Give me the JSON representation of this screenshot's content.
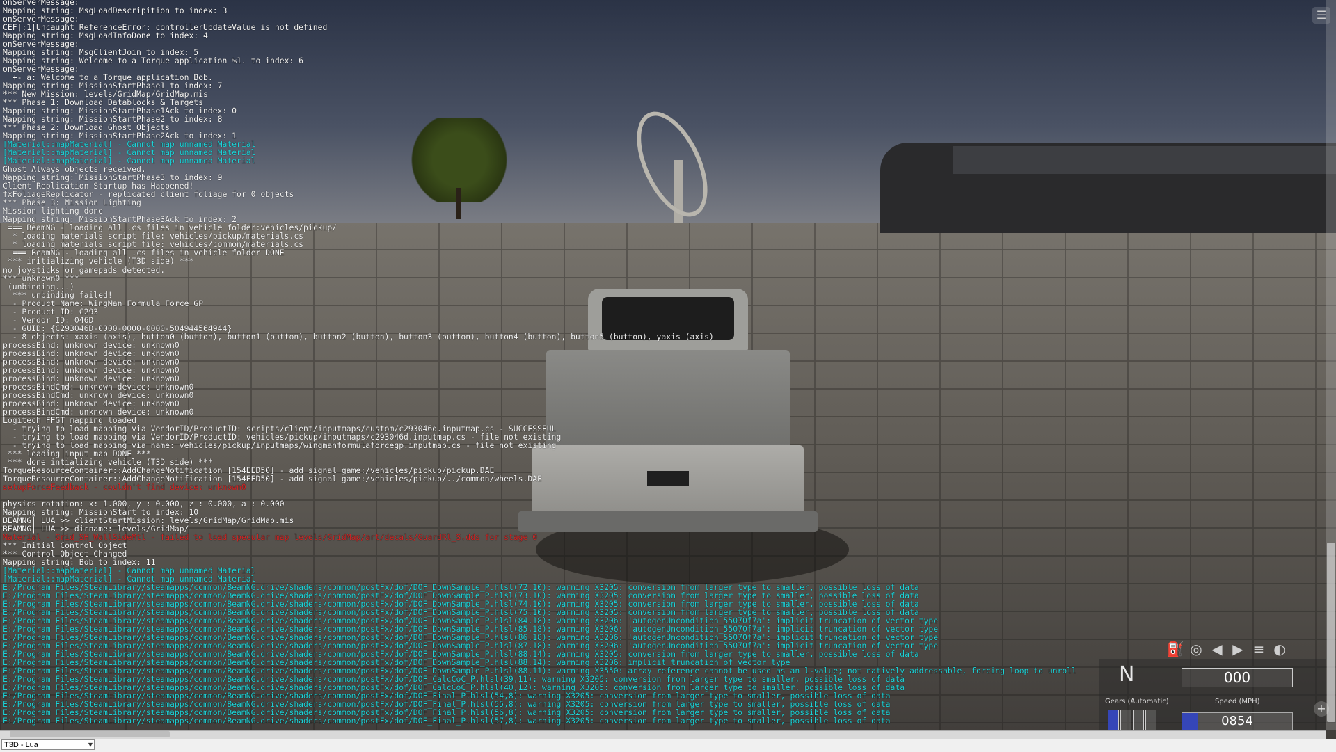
{
  "console": {
    "lines": [
      {
        "text": "onServerMessage:",
        "color": "#f4f4f4"
      },
      {
        "text": "Mapping string: MsgLoadDescripition to index: 3",
        "color": "#f4f4f4"
      },
      {
        "text": "onServerMessage:",
        "color": "#f4f4f4"
      },
      {
        "text": "CEF|:1|Uncaught ReferenceError: controllerUpdateValue is not defined",
        "color": "#f4f4f4"
      },
      {
        "text": "Mapping string: MsgLoadInfoDone to index: 4",
        "color": "#f4f4f4"
      },
      {
        "text": "onServerMessage:",
        "color": "#f4f4f4"
      },
      {
        "text": "Mapping string: MsgClientJoin to index: 5",
        "color": "#f4f4f4"
      },
      {
        "text": "Mapping string: Welcome to a Torque application %1. to index: 6",
        "color": "#f4f4f4"
      },
      {
        "text": "onServerMessage:",
        "color": "#f4f4f4"
      },
      {
        "text": "  +- a: Welcome to a Torque application Bob.",
        "color": "#f4f4f4"
      },
      {
        "text": "Mapping string: MissionStartPhase1 to index: 7",
        "color": "#f4f4f4"
      },
      {
        "text": "*** New Mission: levels/GridMap/GridMap.mis",
        "color": "#f4f4f4"
      },
      {
        "text": "*** Phase 1: Download Datablocks & Targets",
        "color": "#f4f4f4"
      },
      {
        "text": "Mapping string: MissionStartPhase1Ack to index: 0",
        "color": "#f4f4f4"
      },
      {
        "text": "Mapping string: MissionStartPhase2 to index: 8",
        "color": "#f4f4f4"
      },
      {
        "text": "*** Phase 2: Download Ghost Objects",
        "color": "#f4f4f4"
      },
      {
        "text": "Mapping string: MissionStartPhase2Ack to index: 1",
        "color": "#f4f4f4"
      },
      {
        "text": "[Material::mapMaterial] - Cannot map unnamed Material",
        "color": "#1ed3d8"
      },
      {
        "text": "[Material::mapMaterial] - Cannot map unnamed Material",
        "color": "#1ed3d8"
      },
      {
        "text": "[Material::mapMaterial] - Cannot map unnamed Material",
        "color": "#1ed3d8"
      },
      {
        "text": "Ghost Always objects received.",
        "color": "#f4f4f4"
      },
      {
        "text": "Mapping string: MissionStartPhase3 to index: 9",
        "color": "#f4f4f4"
      },
      {
        "text": "Client Replication Startup has Happened!",
        "color": "#f4f4f4"
      },
      {
        "text": "fxFoliageReplicator - replicated client foliage for 0 objects",
        "color": "#f4f4f4"
      },
      {
        "text": "*** Phase 3: Mission Lighting",
        "color": "#f4f4f4"
      },
      {
        "text": "Mission lighting done",
        "color": "#f4f4f4"
      },
      {
        "text": "Mapping string: MissionStartPhase3Ack to index: 2",
        "color": "#f4f4f4"
      },
      {
        "text": " === BeamNG - loading all .cs files in vehicle folder:vehicles/pickup/",
        "color": "#f4f4f4"
      },
      {
        "text": "  * loading materials script file: vehicles/pickup/materials.cs",
        "color": "#f4f4f4"
      },
      {
        "text": "  * loading materials script file: vehicles/common/materials.cs",
        "color": "#f4f4f4"
      },
      {
        "text": "  === BeamNG - loading all .cs files in vehicle folder DONE",
        "color": "#f4f4f4"
      },
      {
        "text": " *** initializing vehicle (T3D side) ***",
        "color": "#f4f4f4"
      },
      {
        "text": "no joysticks or gamepads detected.",
        "color": "#f4f4f4"
      },
      {
        "text": "*** unknown0 ***",
        "color": "#f4f4f4"
      },
      {
        "text": " (unbinding...)",
        "color": "#f4f4f4"
      },
      {
        "text": "  *** unbinding failed!",
        "color": "#f4f4f4"
      },
      {
        "text": "  - Product Name: WingMan Formula Force GP",
        "color": "#f4f4f4"
      },
      {
        "text": "  - Product ID: C293",
        "color": "#f4f4f4"
      },
      {
        "text": "  - Vendor ID: 046D",
        "color": "#f4f4f4"
      },
      {
        "text": "  - GUID: {C293046D-0000-0000-0000-504944564944}",
        "color": "#f4f4f4"
      },
      {
        "text": "  - 8 objects: xaxis (axis), button0 (button), button1 (button), button2 (button), button3 (button), button4 (button), button5 (button), yaxis (axis)",
        "color": "#f4f4f4"
      },
      {
        "text": "processBind: unknown device: unknown0",
        "color": "#f4f4f4"
      },
      {
        "text": "processBind: unknown device: unknown0",
        "color": "#f4f4f4"
      },
      {
        "text": "processBind: unknown device: unknown0",
        "color": "#f4f4f4"
      },
      {
        "text": "processBind: unknown device: unknown0",
        "color": "#f4f4f4"
      },
      {
        "text": "processBind: unknown device: unknown0",
        "color": "#f4f4f4"
      },
      {
        "text": "processBindCmd: unknown device: unknown0",
        "color": "#f4f4f4"
      },
      {
        "text": "processBindCmd: unknown device: unknown0",
        "color": "#f4f4f4"
      },
      {
        "text": "processBind: unknown device: unknown0",
        "color": "#f4f4f4"
      },
      {
        "text": "processBindCmd: unknown device: unknown0",
        "color": "#f4f4f4"
      },
      {
        "text": "Logitech FFGT mapping loaded",
        "color": "#f4f4f4"
      },
      {
        "text": "  - trying to load mapping via VendorID/ProductID: scripts/client/inputmaps/custom/c293046d.inputmap.cs - SUCCESSFUL",
        "color": "#f4f4f4"
      },
      {
        "text": "  - trying to load mapping via VendorID/ProductID: vehicles/pickup/inputmaps/c293046d.inputmap.cs - file not existing",
        "color": "#f4f4f4"
      },
      {
        "text": "  - trying to load mapping via name: vehicles/pickup/inputmaps/wingmanformulaforcegp.inputmap.cs - file not existing",
        "color": "#f4f4f4"
      },
      {
        "text": " *** loading input map DONE ***",
        "color": "#f4f4f4"
      },
      {
        "text": " *** done intializing vehicle (T3D side) ***",
        "color": "#f4f4f4"
      },
      {
        "text": "TorqueResourceContainer::AddChangeNotification [154EED50] - add signal game:/vehicles/pickup/pickup.DAE",
        "color": "#f4f4f4"
      },
      {
        "text": "TorqueResourceContainer::AddChangeNotification [154EED50] - add signal game:/vehicles/pickup/../common/wheels.DAE",
        "color": "#f4f4f4"
      },
      {
        "text": "setupForceFeedback - couldn't find device: unknown0",
        "color": "#d42626"
      },
      {
        "text": "",
        "color": "#f4f4f4"
      },
      {
        "text": "physics rotation: x: 1.000, y : 0.000, z : 0.000, a : 0.000",
        "color": "#f4f4f4"
      },
      {
        "text": "Mapping string: MissionStart to index: 10",
        "color": "#f4f4f4"
      },
      {
        "text": "BEAMNG| LUA >> clientStartMission: levels/GridMap/GridMap.mis",
        "color": "#f4f4f4"
      },
      {
        "text": "BEAMNG| LUA >> dirname: levels/GridMap/",
        "color": "#f4f4f4"
      },
      {
        "text": "Material - Grid_SH_WallSideMtl - failed to load specular map levels/GridMap/art/decals/GuardRl_S.dds for stage 0",
        "color": "#d42626"
      },
      {
        "text": "*** Initial Control Object",
        "color": "#f4f4f4"
      },
      {
        "text": "*** Control Object Changed",
        "color": "#f4f4f4"
      },
      {
        "text": "Mapping string: Bob to index: 11",
        "color": "#f4f4f4"
      },
      {
        "text": "[Material::mapMaterial] - Cannot map unnamed Material",
        "color": "#1ed3d8"
      },
      {
        "text": "[Material::mapMaterial] - Cannot map unnamed Material",
        "color": "#1ed3d8"
      },
      {
        "text": "E:/Program Files/SteamLibrary/steamapps/common/BeamNG.drive/shaders/common/postFx/dof/DOF_DownSample_P.hlsl(72,10): warning X3205: conversion from larger type to smaller, possible loss of data",
        "color": "#1ed3d8"
      },
      {
        "text": "E:/Program Files/SteamLibrary/steamapps/common/BeamNG.drive/shaders/common/postFx/dof/DOF_DownSample_P.hlsl(73,10): warning X3205: conversion from larger type to smaller, possible loss of data",
        "color": "#1ed3d8"
      },
      {
        "text": "E:/Program Files/SteamLibrary/steamapps/common/BeamNG.drive/shaders/common/postFx/dof/DOF_DownSample_P.hlsl(74,10): warning X3205: conversion from larger type to smaller, possible loss of data",
        "color": "#1ed3d8"
      },
      {
        "text": "E:/Program Files/SteamLibrary/steamapps/common/BeamNG.drive/shaders/common/postFx/dof/DOF_DownSample_P.hlsl(75,10): warning X3205: conversion from larger type to smaller, possible loss of data",
        "color": "#1ed3d8"
      },
      {
        "text": "E:/Program Files/SteamLibrary/steamapps/common/BeamNG.drive/shaders/common/postFx/dof/DOF_DownSample_P.hlsl(84,18): warning X3206: 'autogenUncondition_55070f7a': implicit truncation of vector type",
        "color": "#1ed3d8"
      },
      {
        "text": "E:/Program Files/SteamLibrary/steamapps/common/BeamNG.drive/shaders/common/postFx/dof/DOF_DownSample_P.hlsl(85,18): warning X3206: 'autogenUncondition_55070f7a': implicit truncation of vector type",
        "color": "#1ed3d8"
      },
      {
        "text": "E:/Program Files/SteamLibrary/steamapps/common/BeamNG.drive/shaders/common/postFx/dof/DOF_DownSample_P.hlsl(86,18): warning X3206: 'autogenUncondition_55070f7a': implicit truncation of vector type",
        "color": "#1ed3d8"
      },
      {
        "text": "E:/Program Files/SteamLibrary/steamapps/common/BeamNG.drive/shaders/common/postFx/dof/DOF_DownSample_P.hlsl(87,18): warning X3206: 'autogenUncondition_55070f7a': implicit truncation of vector type",
        "color": "#1ed3d8"
      },
      {
        "text": "E:/Program Files/SteamLibrary/steamapps/common/BeamNG.drive/shaders/common/postFx/dof/DOF_DownSample_P.hlsl(88,14): warning X3205: conversion from larger type to smaller, possible loss of data",
        "color": "#1ed3d8"
      },
      {
        "text": "E:/Program Files/SteamLibrary/steamapps/common/BeamNG.drive/shaders/common/postFx/dof/DOF_DownSample_P.hlsl(88,14): warning X3206: implicit truncation of vector type",
        "color": "#1ed3d8"
      },
      {
        "text": "E:/Program Files/SteamLibrary/steamapps/common/BeamNG.drive/shaders/common/postFx/dof/DOF_DownSample_P.hlsl(88,11): warning X3550: array reference cannot be used as an l-value; not natively addressable, forcing loop to unroll",
        "color": "#1ed3d8"
      },
      {
        "text": "E:/Program Files/SteamLibrary/steamapps/common/BeamNG.drive/shaders/common/postFx/dof/DOF_CalcCoC_P.hlsl(39,11): warning X3205: conversion from larger type to smaller, possible loss of data",
        "color": "#1ed3d8"
      },
      {
        "text": "E:/Program Files/SteamLibrary/steamapps/common/BeamNG.drive/shaders/common/postFx/dof/DOF_CalcCoC_P.hlsl(40,12): warning X3205: conversion from larger type to smaller, possible loss of data",
        "color": "#1ed3d8"
      },
      {
        "text": "E:/Program Files/SteamLibrary/steamapps/common/BeamNG.drive/shaders/common/postFx/dof/DOF_Final_P.hlsl(54,8): warning X3205: conversion from larger type to smaller, possible loss of data",
        "color": "#1ed3d8"
      },
      {
        "text": "E:/Program Files/SteamLibrary/steamapps/common/BeamNG.drive/shaders/common/postFx/dof/DOF_Final_P.hlsl(55,8): warning X3205: conversion from larger type to smaller, possible loss of data",
        "color": "#1ed3d8"
      },
      {
        "text": "E:/Program Files/SteamLibrary/steamapps/common/BeamNG.drive/shaders/common/postFx/dof/DOF_Final_P.hlsl(56,8): warning X3205: conversion from larger type to smaller, possible loss of data",
        "color": "#1ed3d8"
      },
      {
        "text": "E:/Program Files/SteamLibrary/steamapps/common/BeamNG.drive/shaders/common/postFx/dof/DOF_Final_P.hlsl(57,8): warning X3205: conversion from larger type to smaller, possible loss of data",
        "color": "#1ed3d8"
      }
    ]
  },
  "hud": {
    "gear": "N",
    "gears_label": "Gears (Automatic)",
    "speed_label": "Speed (MPH)",
    "speed_value": "000",
    "rpm_value": "0854",
    "icons": [
      "fuel-icon",
      "abs-icon",
      "left-arrow-icon",
      "right-arrow-icon",
      "headlight-icon",
      "brake-warning-icon"
    ],
    "icon_glyphs": [
      "⛽",
      "◎",
      "◀",
      "▶",
      "≡",
      "◐"
    ]
  },
  "bottom_bar": {
    "mode_value": "T3D - Lua",
    "cmd_value": ""
  },
  "colors": {
    "log_default": "#f4f4f4",
    "log_warning": "#1ed3d8",
    "log_error": "#d42626"
  }
}
